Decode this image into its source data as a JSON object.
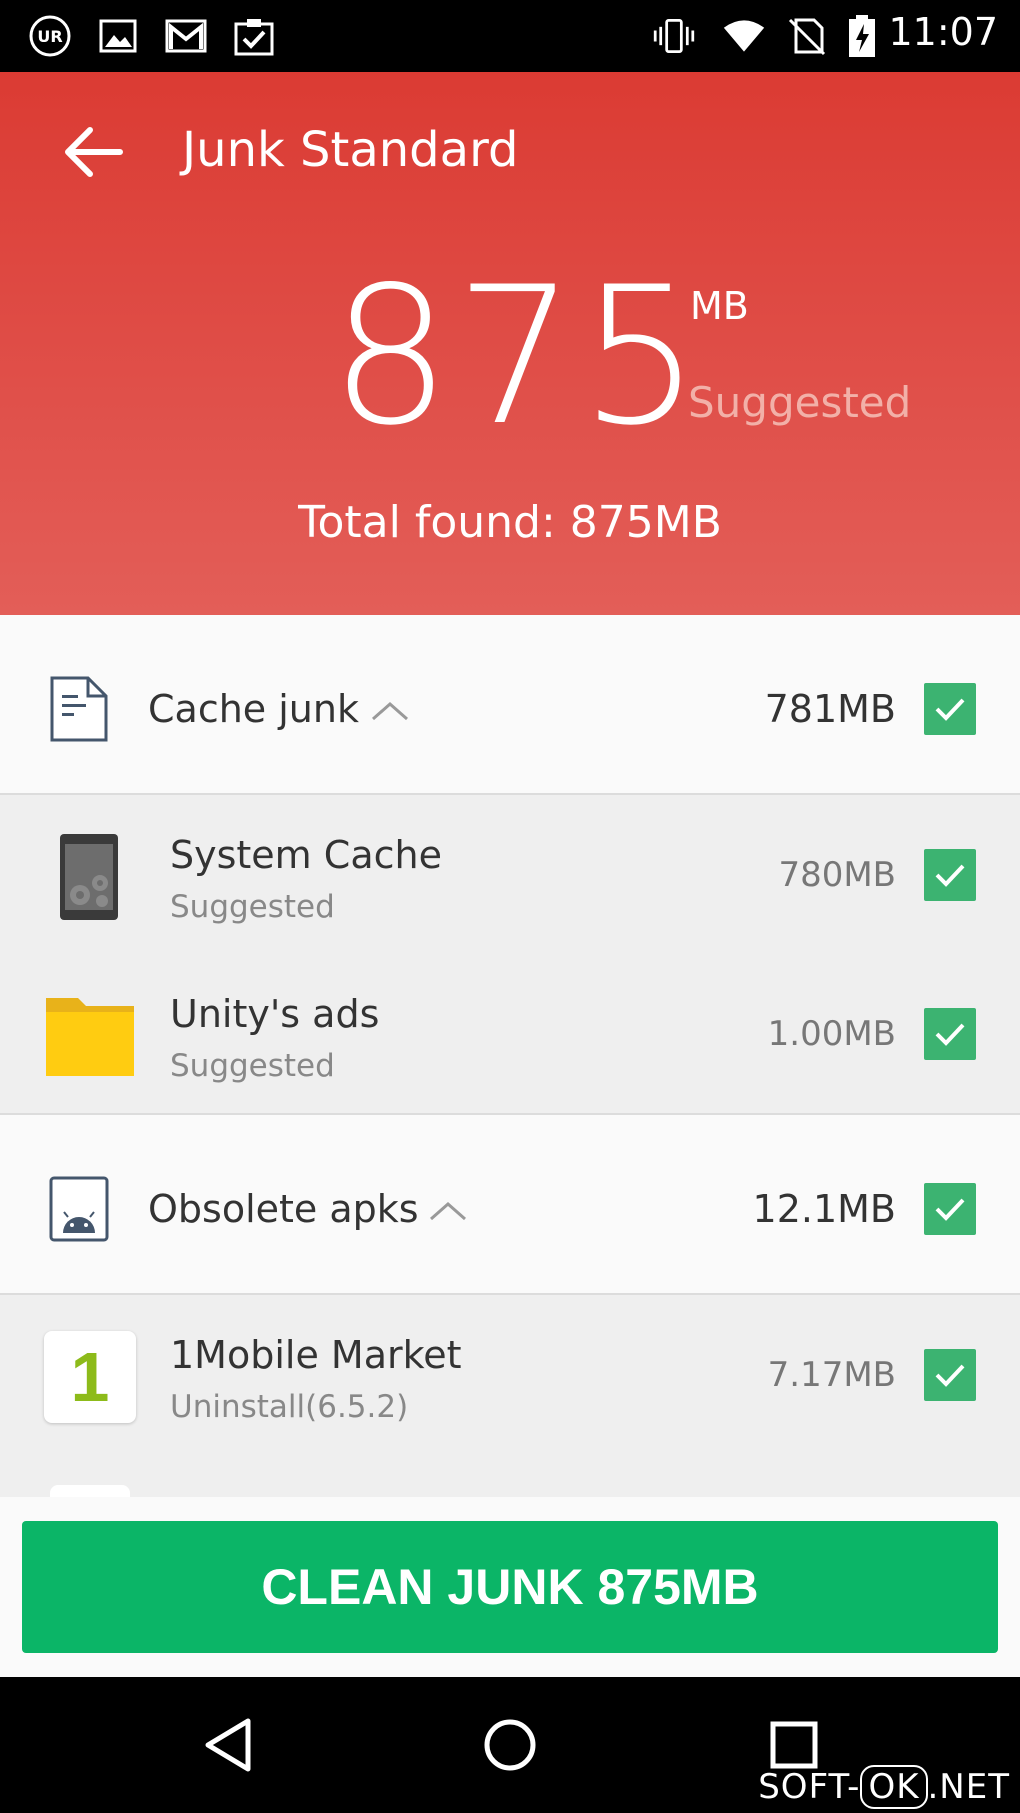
{
  "status_bar": {
    "time": "11:07",
    "left_icons": [
      "ur-icon",
      "image-icon",
      "gmail-icon",
      "clipboard-check-icon"
    ],
    "right_icons": [
      "vibrate-icon",
      "wifi-icon",
      "no-sim-icon",
      "battery-charging-icon"
    ]
  },
  "header": {
    "title": "Junk Standard",
    "amount": "875",
    "unit": "MB",
    "suggested": "Suggested",
    "total": "Total found: 875MB",
    "color": "#db3b33"
  },
  "groups": [
    {
      "label": "Cache junk",
      "size": "781MB",
      "icon": "document-icon",
      "items": [
        {
          "name": "System Cache",
          "sub": "Suggested",
          "size": "780MB",
          "icon": "phone-gear-icon"
        },
        {
          "name": "Unity's ads",
          "sub": "Suggested",
          "size": "1.00MB",
          "icon": "folder-icon"
        }
      ]
    },
    {
      "label": "Obsolete apks",
      "size": "12.1MB",
      "icon": "android-apk-icon",
      "items": [
        {
          "name": "1Mobile Market",
          "sub": "Uninstall(6.5.2)",
          "size": "7.17MB",
          "icon": "one-mobile-icon",
          "icon_text": "1"
        }
      ]
    }
  ],
  "action": {
    "label": "CLEAN JUNK 875MB",
    "color": "#0bb567"
  },
  "nav": {
    "icons": [
      "back-triangle-icon",
      "home-circle-icon",
      "recents-square-icon"
    ]
  },
  "watermark": {
    "pre": "SOFT-",
    "box": "OK",
    "post": ".NET"
  },
  "check_color": "#3cb371"
}
